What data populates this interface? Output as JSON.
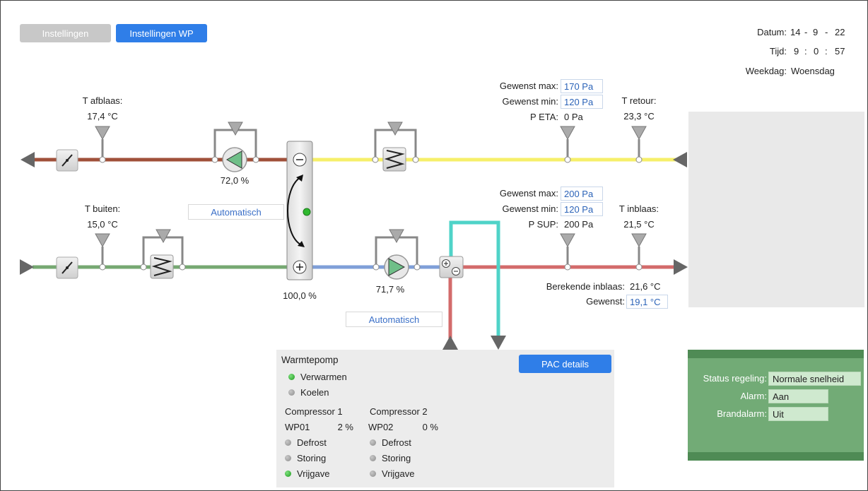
{
  "tabs": {
    "instellingen": "Instellingen",
    "instellingen_wp": "Instellingen WP"
  },
  "datetime": {
    "datum_label": "Datum:",
    "datum": [
      "14",
      "9",
      "22"
    ],
    "tijd_label": "Tijd:",
    "tijd": [
      "9",
      "0",
      "57"
    ],
    "weekdag_label": "Weekdag:",
    "weekdag": "Woensdag"
  },
  "exhaust": {
    "t_afblaas_label": "T afblaas:",
    "t_afblaas": "17,4 °C",
    "fan_pct": "72,0 %",
    "gewenst_max_label": "Gewenst max:",
    "gewenst_max": "170 Pa",
    "gewenst_min_label": "Gewenst min:",
    "gewenst_min": "120 Pa",
    "p_label": "P ETA:",
    "p_value": "0 Pa",
    "t_retour_label": "T retour:",
    "t_retour": "23,3 °C"
  },
  "supply": {
    "t_buiten_label": "T buiten:",
    "t_buiten": "15,0 °C",
    "auto_left": "Automatisch",
    "wheel_pct": "100,0 %",
    "fan_pct": "71,7 %",
    "auto_right": "Automatisch",
    "gewenst_max_label": "Gewenst max:",
    "gewenst_max": "200 Pa",
    "gewenst_min_label": "Gewenst min:",
    "gewenst_min": "120 Pa",
    "p_label": "P SUP:",
    "p_value": "200 Pa",
    "t_inblaas_label": "T inblaas:",
    "t_inblaas": "21,5 °C",
    "berekende_label": "Berekende inblaas:",
    "berekende": "21,6 °C",
    "gewenst_label": "Gewenst:",
    "gewenst": "19,1 °C"
  },
  "heatpump": {
    "title": "Warmtepomp",
    "details_btn": "PAC details",
    "modes": [
      {
        "label": "Verwarmen",
        "on": true
      },
      {
        "label": "Koelen",
        "on": false
      }
    ],
    "compressors": [
      {
        "title": "Compressor 1",
        "id": "WP01",
        "pct": "2 %",
        "states": [
          {
            "label": "Defrost",
            "on": false
          },
          {
            "label": "Storing",
            "on": false
          },
          {
            "label": "Vrijgave",
            "on": true
          }
        ]
      },
      {
        "title": "Compressor 2",
        "id": "WP02",
        "pct": "0 %",
        "states": [
          {
            "label": "Defrost",
            "on": false
          },
          {
            "label": "Storing",
            "on": false
          },
          {
            "label": "Vrijgave",
            "on": false
          }
        ]
      }
    ]
  },
  "status": {
    "regeling_label": "Status regeling:",
    "regeling": "Normale snelheid",
    "alarm_label": "Alarm:",
    "alarm": "Aan",
    "brandalarm_label": "Brandalarm:",
    "brandalarm": "Uit"
  },
  "colors": {
    "exhaust_pipe": "#a0503a",
    "return_pipe": "#f6ef6a",
    "outdoor_pipe": "#76a872",
    "supply_mix_pipe": "#7f9fd8",
    "supply_pipe": "#d36b6b",
    "hp_supply_pipe": "#4fd3c8",
    "tab_disabled": "#c8c8c8",
    "tab_active": "#2f7ee8"
  }
}
